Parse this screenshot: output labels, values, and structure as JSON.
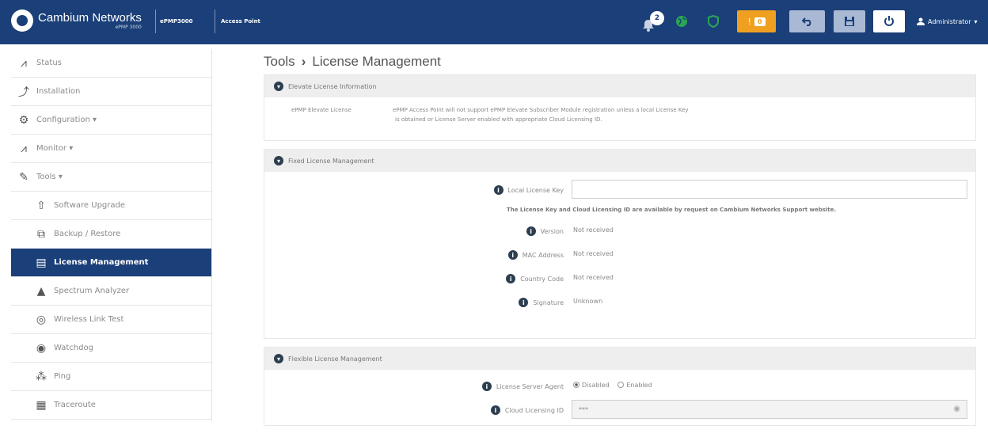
{
  "header": {
    "brand": "Cambium Networks",
    "product": "ePMP 3000",
    "model_label": "ePMP3000",
    "mode_label": "Access Point",
    "notifications_count": "2",
    "alerts_count": "0",
    "user_label": "Administrator",
    "icons": [
      "bell-icon",
      "globe-icon",
      "shield-icon",
      "warning-icon",
      "undo-icon",
      "save-icon",
      "power-icon",
      "user-icon"
    ],
    "colors": {
      "bar": "#1b3f78",
      "warning": "#f0a020",
      "button": "#a9b9d4",
      "globe": "#2aa655",
      "shield": "#2aa655"
    }
  },
  "sidebar": {
    "items": [
      {
        "label": "Status",
        "icon": "pulse-icon"
      },
      {
        "label": "Installation",
        "icon": "installation-icon"
      },
      {
        "label": "Configuration ▾",
        "icon": "gear-icon"
      },
      {
        "label": "Monitor ▾",
        "icon": "pulse-icon"
      },
      {
        "label": "Tools ▾",
        "icon": "wrench-icon"
      },
      {
        "label": "Software Upgrade",
        "icon": "upgrade-icon"
      },
      {
        "label": "Backup / Restore",
        "icon": "backup-icon"
      },
      {
        "label": "License Management",
        "icon": "license-icon"
      },
      {
        "label": "Spectrum Analyzer",
        "icon": "spectrum-icon"
      },
      {
        "label": "Wireless Link Test",
        "icon": "wireless-icon"
      },
      {
        "label": "Watchdog",
        "icon": "eye-icon"
      },
      {
        "label": "Ping",
        "icon": "ping-icon"
      },
      {
        "label": "Traceroute",
        "icon": "traceroute-icon"
      }
    ]
  },
  "main": {
    "title_section": "Tools",
    "title_arrow": "›",
    "title_page": "License Management",
    "elevate": {
      "heading": "Elevate License Information",
      "label": "ePMP Elevate License",
      "text_line1": "ePMP Access Point will not support ePMP Elevate Subscriber Module registration unless a local License Key",
      "text_line2": "is obtained or License Server enabled with appropriate Cloud Licensing ID."
    },
    "fixed": {
      "heading": "Fixed License Management",
      "key_label": "Local License Key",
      "key_value": "",
      "note": "The License Key and Cloud Licensing ID are available by request on Cambium Networks Support website.",
      "rows": [
        {
          "label": "Version",
          "value": "Not received"
        },
        {
          "label": "MAC Address",
          "value": "Not received"
        },
        {
          "label": "Country Code",
          "value": "Not received"
        },
        {
          "label": "Signature",
          "value": "Unknown"
        }
      ]
    },
    "flexible": {
      "heading": "Flexible License Management",
      "agent_label": "License Server Agent",
      "agent_options": [
        "Disabled",
        "Enabled"
      ],
      "agent_selected": "Disabled",
      "cloud_label": "Cloud Licensing ID",
      "cloud_value": "***"
    }
  }
}
